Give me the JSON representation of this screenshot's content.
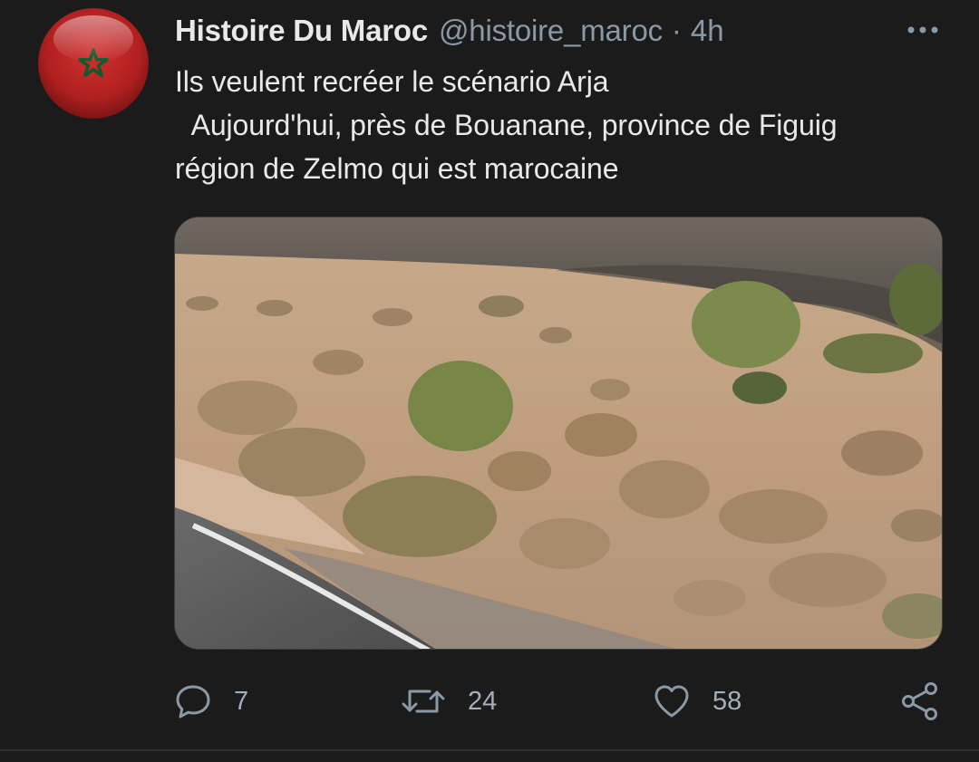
{
  "tweet": {
    "author": {
      "display_name": "Histoire Du Maroc",
      "handle": "@histoire_maroc",
      "avatar_icon": "morocco-flag-icon"
    },
    "separator": "·",
    "time": "4h",
    "text": "Ils veulent recréer le scénario Arja\n  Aujourd'hui, près de Bouanane, province de Figuig\nrégion de Zelmo qui est marocaine",
    "media": {
      "type": "photo",
      "subject": "desert-road-with-shrubs"
    },
    "actions": {
      "reply": {
        "icon": "reply-icon",
        "count": "7"
      },
      "retweet": {
        "icon": "retweet-icon",
        "count": "24"
      },
      "like": {
        "icon": "heart-icon",
        "count": "58"
      },
      "share": {
        "icon": "share-icon"
      }
    }
  },
  "colors": {
    "background": "#1b1b1b",
    "text_primary": "#e7e9ea",
    "text_secondary": "#8b98a5",
    "divider": "#2f3336",
    "flag_red": "#c1272d",
    "flag_green": "#006233"
  }
}
